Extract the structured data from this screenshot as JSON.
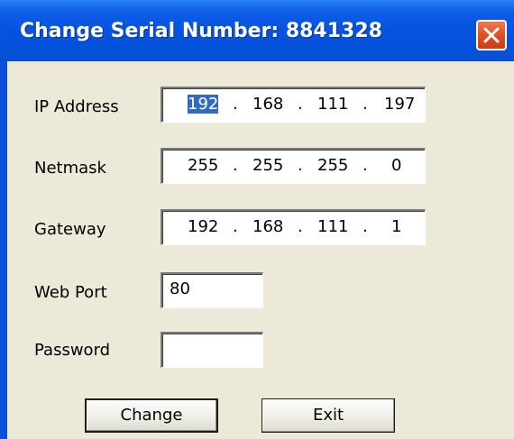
{
  "window": {
    "title": "Change Serial Number: 8841328",
    "close_icon": "close-icon"
  },
  "colors": {
    "titlebar": "#0553e0",
    "client": "#ece9d8",
    "selection": "#316ac5",
    "close": "#e0522a"
  },
  "form": {
    "ip_address": {
      "label": "IP Address",
      "octets": [
        "192",
        "168",
        "111",
        "197"
      ],
      "selected_octet": "192"
    },
    "netmask": {
      "label": "Netmask",
      "octets": [
        "255",
        "255",
        "255",
        "0"
      ]
    },
    "gateway": {
      "label": "Gateway",
      "octets": [
        "192",
        "168",
        "111",
        "1"
      ]
    },
    "web_port": {
      "label": "Web Port",
      "value": "80"
    },
    "password": {
      "label": "Password",
      "value": ""
    },
    "separator": "."
  },
  "buttons": {
    "change": "Change",
    "exit": "Exit"
  }
}
